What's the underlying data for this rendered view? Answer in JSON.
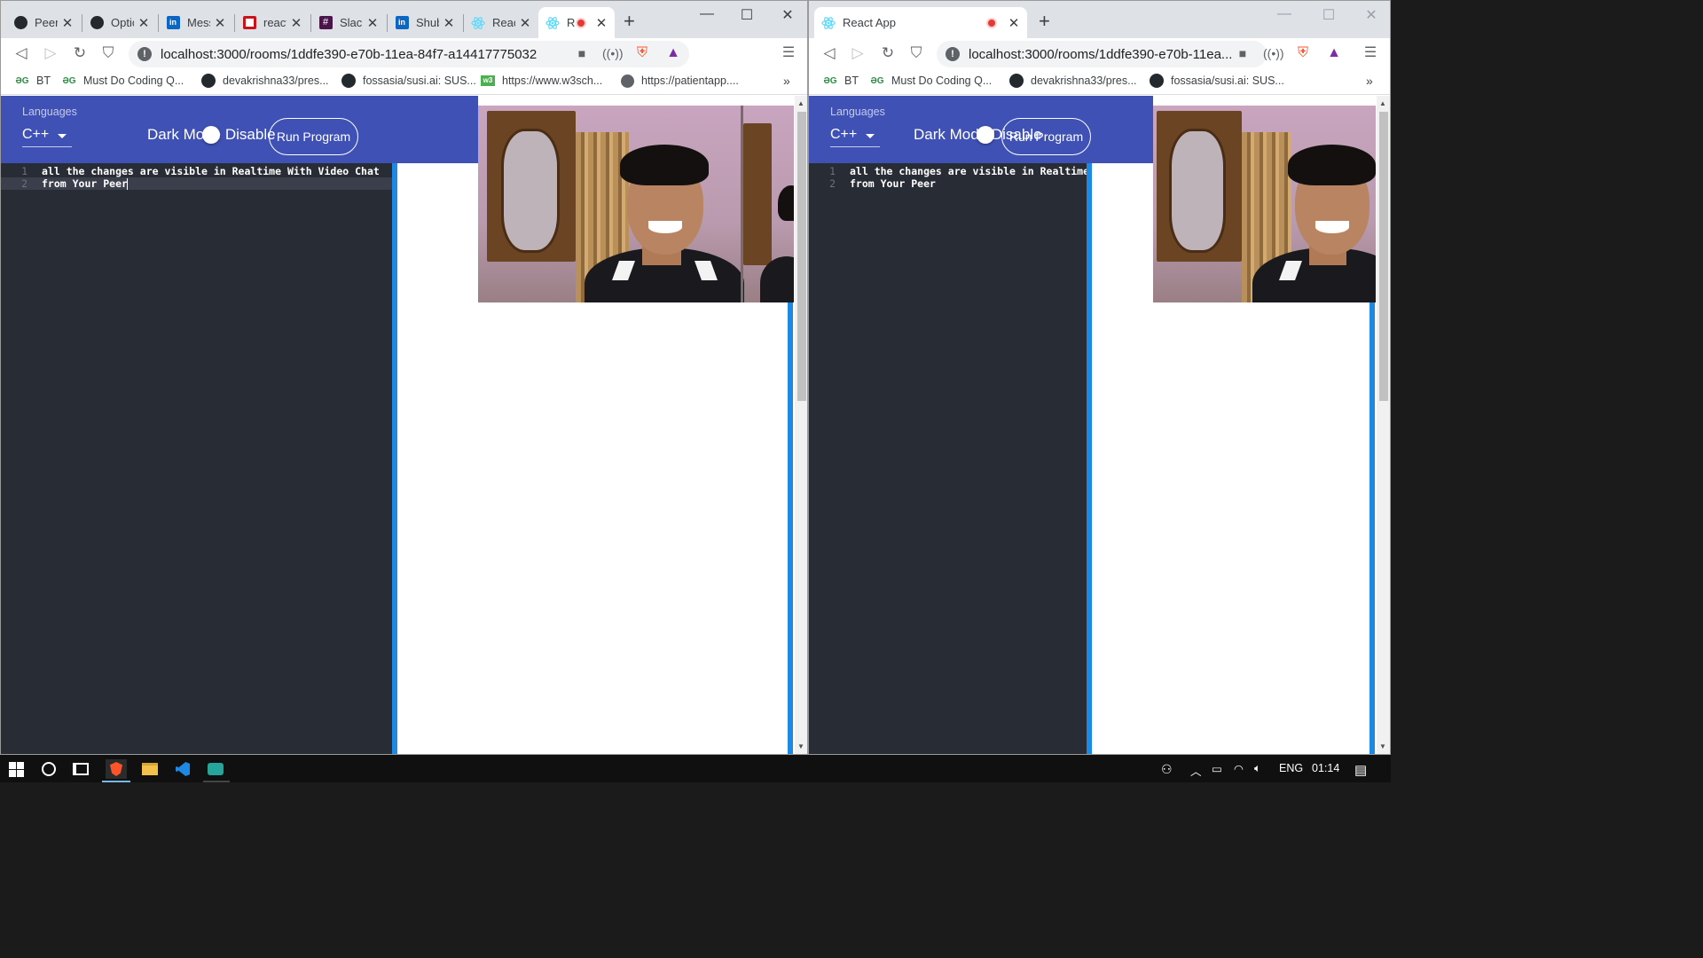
{
  "left_window": {
    "tabs": [
      {
        "title": "PeerC",
        "icon": "github-icon"
      },
      {
        "title": "Optic",
        "icon": "github-icon"
      },
      {
        "title": "Mess",
        "icon": "linkedin-icon"
      },
      {
        "title": "react",
        "icon": "n-icon"
      },
      {
        "title": "Slack",
        "icon": "slack-icon"
      },
      {
        "title": "Shub",
        "icon": "linkedin-icon"
      },
      {
        "title": "React",
        "icon": "react-icon"
      },
      {
        "title": "R",
        "icon": "react-icon"
      }
    ],
    "url": "localhost:3000/rooms/1ddfe390-e70b-11ea-84f7-a14417775032",
    "bookmarks": [
      {
        "label": "BT",
        "icon": "gfg-icon"
      },
      {
        "label": "Must Do Coding Q...",
        "icon": "gfg-icon"
      },
      {
        "label": "devakrishna33/pres...",
        "icon": "github-icon"
      },
      {
        "label": "fossasia/susi.ai: SUS...",
        "icon": "github-icon"
      },
      {
        "label": "https://www.w3sch...",
        "icon": "w3-icon"
      },
      {
        "label": "https://patientapp....",
        "icon": "globe-icon"
      }
    ],
    "bookmarks_more": "»",
    "app": {
      "languages_label": "Languages",
      "language_value": "C++",
      "dark_mode_text": "Dark Mode Disable",
      "run_button": "Run Program",
      "editor_lines": [
        {
          "num": "1",
          "text": "all the changes are visible in Realtime With Video Chat"
        },
        {
          "num": "2",
          "text": "from Your Peer"
        }
      ]
    }
  },
  "right_window": {
    "tab_title": "React App",
    "url": "localhost:3000/rooms/1ddfe390-e70b-11ea...",
    "bookmarks": [
      {
        "label": "BT",
        "icon": "gfg-icon"
      },
      {
        "label": "Must Do Coding Q...",
        "icon": "gfg-icon"
      },
      {
        "label": "devakrishna33/pres...",
        "icon": "github-icon"
      },
      {
        "label": "fossasia/susi.ai: SUS...",
        "icon": "github-icon"
      }
    ],
    "bookmarks_more": "»",
    "app": {
      "languages_label": "Languages",
      "language_value": "C++",
      "dark_mode_text": "Dark Mode Disable",
      "run_button": "Run Program",
      "editor_lines": [
        {
          "num": "1",
          "text": "all the changes are visible in Realtime"
        },
        {
          "num": "2",
          "text": "from Your Peer"
        }
      ]
    }
  },
  "taskbar": {
    "language": "ENG",
    "time": "01:14"
  },
  "colors": {
    "app_bar": "#3f51b5",
    "editor_bg": "#282c34",
    "accent_blue": "#1e88e5",
    "recording_red": "#e53935"
  }
}
